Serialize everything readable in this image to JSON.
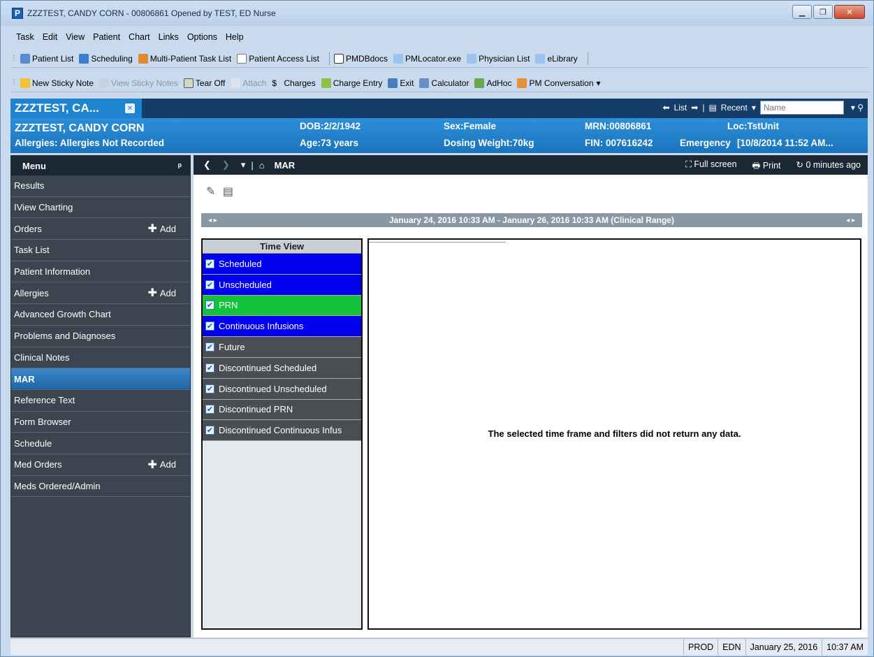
{
  "window": {
    "title": "ZZZTEST, CANDY CORN - 00806861 Opened by TEST, ED Nurse",
    "app_icon": "P"
  },
  "menubar": [
    "Task",
    "Edit",
    "View",
    "Patient",
    "Chart",
    "Links",
    "Options",
    "Help"
  ],
  "toolbar1": [
    "Patient List",
    "Scheduling",
    "Multi-Patient Task List",
    "Patient Access List",
    "PMDBdocs",
    "PMLocator.exe",
    "Physician List",
    "eLibrary"
  ],
  "toolbar2": [
    {
      "label": "New Sticky Note",
      "disabled": false
    },
    {
      "label": "View Sticky Notes",
      "disabled": true
    },
    {
      "label": "Tear Off",
      "disabled": false
    },
    {
      "label": "Attach",
      "disabled": true
    },
    {
      "label": "Charges",
      "disabled": false
    },
    {
      "label": "Charge Entry",
      "disabled": false
    },
    {
      "label": "Exit",
      "disabled": false
    },
    {
      "label": "Calculator",
      "disabled": false
    },
    {
      "label": "AdHoc",
      "disabled": false
    },
    {
      "label": "PM Conversation",
      "disabled": false
    }
  ],
  "patient_tab": {
    "label": "ZZZTEST, CA...",
    "list_label": "List",
    "recent_label": "Recent",
    "name_placeholder": "Name"
  },
  "banner": {
    "name": "ZZZTEST, CANDY CORN",
    "allergies": "Allergies: Allergies Not Recorded",
    "dob": "DOB:2/2/1942",
    "age": "Age:73 years",
    "sex": "Sex:Female",
    "dosing_weight": "Dosing Weight:70kg",
    "mrn": "MRN:00806861",
    "fin": "FIN: 007616242",
    "encounter": "Emergency",
    "visit_date": "[10/8/2014 11:52 AM...",
    "loc": "Loc:TstUnit"
  },
  "leftnav": {
    "header": "Menu",
    "items": [
      {
        "label": "Results",
        "add": false
      },
      {
        "label": "IView Charting",
        "add": false
      },
      {
        "label": "Orders",
        "add": true
      },
      {
        "label": "Task List",
        "add": false
      },
      {
        "label": "Patient Information",
        "add": false
      },
      {
        "label": "Allergies",
        "add": true
      },
      {
        "label": "Advanced Growth Chart",
        "add": false
      },
      {
        "label": "Problems and Diagnoses",
        "add": false
      },
      {
        "label": "Clinical Notes",
        "add": false
      },
      {
        "label": "MAR",
        "add": false,
        "active": true
      },
      {
        "label": "Reference Text",
        "add": false
      },
      {
        "label": "Form Browser",
        "add": false
      },
      {
        "label": "Schedule",
        "add": false
      },
      {
        "label": "Med Orders",
        "add": true
      },
      {
        "label": "Meds Ordered/Admin",
        "add": false
      }
    ],
    "add_label": "Add"
  },
  "content": {
    "title": "MAR",
    "full_screen": "Full screen",
    "print": "Print",
    "refresh": "0 minutes ago",
    "range": "January 24, 2016 10:33 AM - January 26, 2016 10:33 AM (Clinical Range)",
    "time_view_header": "Time View",
    "time_view_items": [
      {
        "label": "Scheduled",
        "color": "blue"
      },
      {
        "label": "Unscheduled",
        "color": "blue"
      },
      {
        "label": "PRN",
        "color": "green"
      },
      {
        "label": "Continuous Infusions",
        "color": "blue"
      },
      {
        "label": "Future",
        "color": "grey"
      },
      {
        "label": "Discontinued Scheduled",
        "color": "grey"
      },
      {
        "label": "Discontinued Unscheduled",
        "color": "grey"
      },
      {
        "label": "Discontinued PRN",
        "color": "grey"
      },
      {
        "label": "Discontinued Continuous Infus",
        "color": "grey"
      }
    ],
    "no_data": "The selected time frame and filters did not return any data."
  },
  "status": {
    "env": "PROD",
    "user": "EDN",
    "date": "January 25, 2016",
    "time": "10:37 AM"
  },
  "colors": {
    "banner": "#1f84d0",
    "nav_bg": "#3b4550",
    "scheduled": "#0000ee",
    "prn": "#12c33a",
    "discontinued": "#4a4d52"
  }
}
